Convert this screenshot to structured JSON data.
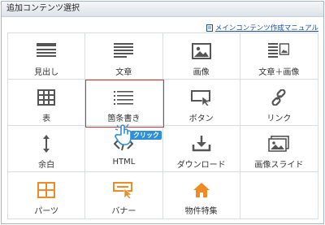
{
  "window": {
    "title": "追加コンテンツ選択"
  },
  "manual_link": {
    "label": "メインコンテンツ作成マニュアル",
    "icon": "document-icon"
  },
  "items": [
    {
      "label": "見出し",
      "icon": "heading-icon"
    },
    {
      "label": "文章",
      "icon": "text-icon"
    },
    {
      "label": "画像",
      "icon": "image-icon"
    },
    {
      "label": "文章＋画像",
      "icon": "text-image-icon"
    },
    {
      "label": "表",
      "icon": "table-icon"
    },
    {
      "label": "箇条書き",
      "icon": "list-icon"
    },
    {
      "label": "ボタン",
      "icon": "button-icon"
    },
    {
      "label": "リンク",
      "icon": "link-icon"
    },
    {
      "label": "余白",
      "icon": "spacing-icon"
    },
    {
      "label": "HTML",
      "icon": "html-icon"
    },
    {
      "label": "ダウンロード",
      "icon": "download-icon"
    },
    {
      "label": "画像スライド",
      "icon": "slideshow-icon"
    },
    {
      "label": "パーツ",
      "icon": "parts-icon"
    },
    {
      "label": "バナー",
      "icon": "banner-icon"
    },
    {
      "label": "物件特集",
      "icon": "property-feature-icon"
    }
  ],
  "selected_item": "箇条書き",
  "click_badge": "クリック",
  "colors": {
    "accent": "#2d8fd6",
    "highlight": "#d9342b",
    "orange": "#f08a24",
    "icon_gray": "#555555"
  }
}
